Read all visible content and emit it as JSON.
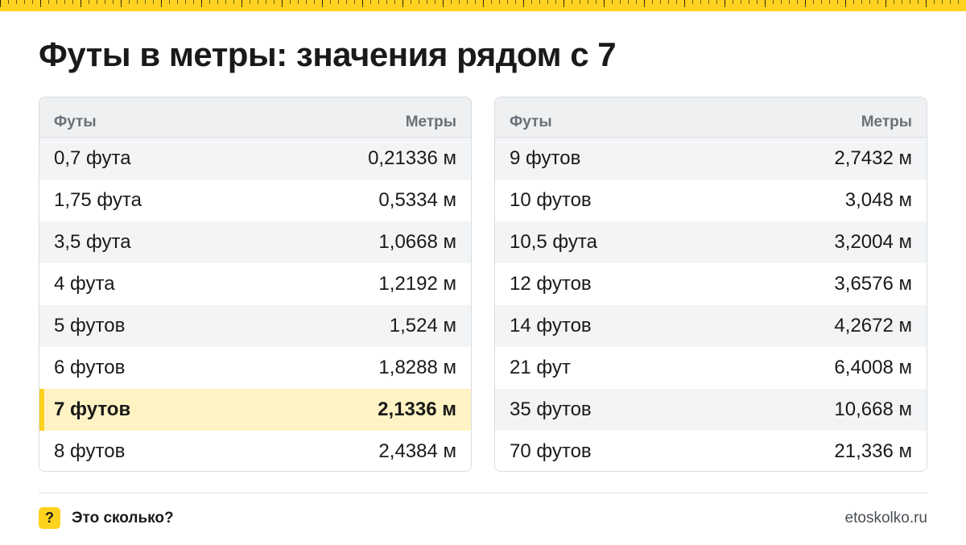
{
  "title": "Футы в метры: значения рядом с 7",
  "colors": {
    "accent": "#ffd21f",
    "highlight": "#fff3c4",
    "header_bg": "#eef0f2"
  },
  "tables": [
    {
      "header": {
        "left": "Футы",
        "right": "Метры"
      },
      "rows": [
        {
          "feet": "0,7 фута",
          "meters": "0,21336 м"
        },
        {
          "feet": "1,75 фута",
          "meters": "0,5334 м"
        },
        {
          "feet": "3,5 фута",
          "meters": "1,0668 м"
        },
        {
          "feet": "4 фута",
          "meters": "1,2192 м"
        },
        {
          "feet": "5 футов",
          "meters": "1,524 м"
        },
        {
          "feet": "6 футов",
          "meters": "1,8288 м"
        },
        {
          "feet": "7 футов",
          "meters": "2,1336 м",
          "highlighted": true
        },
        {
          "feet": "8 футов",
          "meters": "2,4384 м"
        }
      ]
    },
    {
      "header": {
        "left": "Футы",
        "right": "Метры"
      },
      "rows": [
        {
          "feet": "9 футов",
          "meters": "2,7432 м"
        },
        {
          "feet": "10 футов",
          "meters": "3,048 м"
        },
        {
          "feet": "10,5 фута",
          "meters": "3,2004 м"
        },
        {
          "feet": "12 футов",
          "meters": "3,6576 м"
        },
        {
          "feet": "14 футов",
          "meters": "4,2672 м"
        },
        {
          "feet": "21 фут",
          "meters": "6,4008 м"
        },
        {
          "feet": "35 футов",
          "meters": "10,668 м"
        },
        {
          "feet": "70 футов",
          "meters": "21,336 м"
        }
      ]
    }
  ],
  "footer": {
    "badge_icon": "question-mark-icon",
    "badge_text": "?",
    "brand": "Это сколько?",
    "site": "etoskolko.ru"
  }
}
